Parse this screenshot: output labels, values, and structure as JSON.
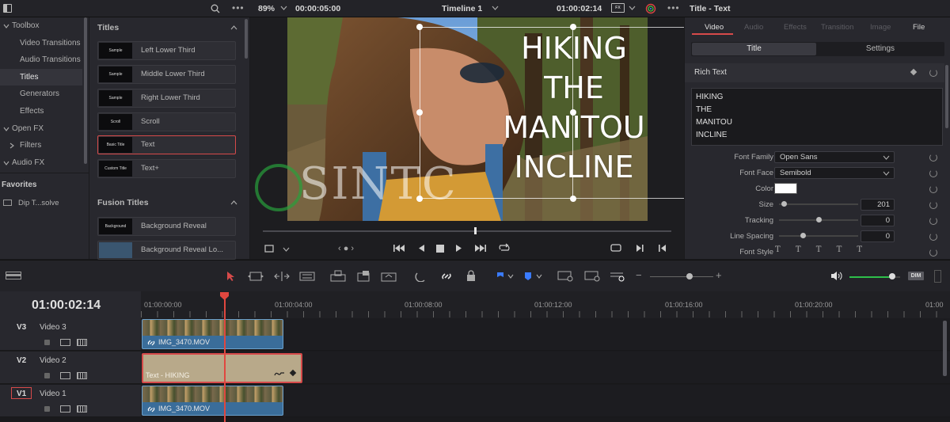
{
  "viewer": {
    "zoom": "89%",
    "timecode_left": "00:00:05:00",
    "timeline_name": "Timeline 1",
    "timecode_right": "01:00:02:14",
    "overlay_text": [
      "HIKING",
      "THE",
      "MANITOU",
      "INCLINE"
    ],
    "watermark": "SINTC"
  },
  "toolbox": {
    "items": [
      {
        "label": "Toolbox"
      },
      {
        "label": "Video Transitions"
      },
      {
        "label": "Audio Transitions"
      },
      {
        "label": "Titles"
      },
      {
        "label": "Generators"
      },
      {
        "label": "Effects"
      },
      {
        "label": "Open FX"
      },
      {
        "label": "Filters"
      },
      {
        "label": "Audio FX"
      }
    ],
    "favorites_label": "Favorites",
    "favorite_item": "Dip T...solve"
  },
  "titles_panel": {
    "section1": "Titles",
    "items": [
      {
        "thumb": "Sample",
        "label": "Left Lower Third"
      },
      {
        "thumb": "Sample",
        "label": "Middle Lower Third"
      },
      {
        "thumb": "Sample",
        "label": "Right Lower Third"
      },
      {
        "thumb": "Scroll",
        "label": "Scroll"
      },
      {
        "thumb": "Basic Title",
        "label": "Text"
      },
      {
        "thumb": "Custom Title",
        "label": "Text+"
      }
    ],
    "section2": "Fusion Titles",
    "fusion_items": [
      {
        "thumb": "Background Reveal",
        "label": "Background Reveal"
      },
      {
        "thumb": "",
        "label": "Background Reveal Lo..."
      }
    ]
  },
  "inspector": {
    "title": "Title - Text",
    "tabs": [
      "Video",
      "Audio",
      "Effects",
      "Transition",
      "Image",
      "File"
    ],
    "subtabs": [
      "Title",
      "Settings"
    ],
    "rich_text_label": "Rich Text",
    "rich_text_lines": [
      "HIKING",
      "THE",
      "MANITOU",
      "INCLINE"
    ],
    "font_family_label": "Font Family",
    "font_family": "Open Sans",
    "font_face_label": "Font Face",
    "font_face": "Semibold",
    "color_label": "Color",
    "color_value": "#ffffff",
    "size_label": "Size",
    "size_value": "201",
    "size_level": 0.06,
    "tracking_label": "Tracking",
    "tracking_value": "0",
    "tracking_level": 0.5,
    "line_spacing_label": "Line Spacing",
    "line_spacing_value": "0",
    "line_spacing_level": 0.3,
    "font_style_label": "Font Style"
  },
  "timeline": {
    "current_tc": "01:00:02:14",
    "ruler": [
      "01:00:00:00",
      "01:00:04:00",
      "01:00:08:00",
      "01:00:12:00",
      "01:00:16:00",
      "01:00:20:00",
      "01:00"
    ],
    "tracks": [
      {
        "id": "V3",
        "name": "Video 3",
        "clip": "IMG_3470.MOV"
      },
      {
        "id": "V2",
        "name": "Video 2",
        "clip": "Text - HIKING"
      },
      {
        "id": "V1",
        "name": "Video 1",
        "clip": "IMG_3470.MOV"
      }
    ],
    "dim_label": "DIM",
    "volume_level": 0.85
  },
  "colors": {
    "accent_red": "#d64a4a",
    "clip_blue": "#3a6d9a",
    "text_clip": "#b8a98a",
    "volume_green": "#2ebf4a"
  }
}
